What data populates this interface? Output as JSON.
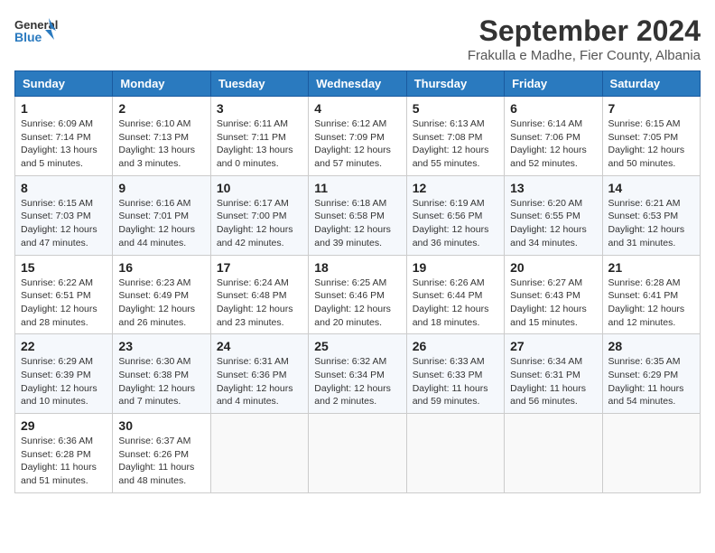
{
  "logo": {
    "line1": "General",
    "line2": "Blue"
  },
  "title": {
    "month_year": "September 2024",
    "location": "Frakulla e Madhe, Fier County, Albania"
  },
  "header_days": [
    "Sunday",
    "Monday",
    "Tuesday",
    "Wednesday",
    "Thursday",
    "Friday",
    "Saturday"
  ],
  "weeks": [
    [
      {
        "day": "1",
        "info": "Sunrise: 6:09 AM\nSunset: 7:14 PM\nDaylight: 13 hours\nand 5 minutes."
      },
      {
        "day": "2",
        "info": "Sunrise: 6:10 AM\nSunset: 7:13 PM\nDaylight: 13 hours\nand 3 minutes."
      },
      {
        "day": "3",
        "info": "Sunrise: 6:11 AM\nSunset: 7:11 PM\nDaylight: 13 hours\nand 0 minutes."
      },
      {
        "day": "4",
        "info": "Sunrise: 6:12 AM\nSunset: 7:09 PM\nDaylight: 12 hours\nand 57 minutes."
      },
      {
        "day": "5",
        "info": "Sunrise: 6:13 AM\nSunset: 7:08 PM\nDaylight: 12 hours\nand 55 minutes."
      },
      {
        "day": "6",
        "info": "Sunrise: 6:14 AM\nSunset: 7:06 PM\nDaylight: 12 hours\nand 52 minutes."
      },
      {
        "day": "7",
        "info": "Sunrise: 6:15 AM\nSunset: 7:05 PM\nDaylight: 12 hours\nand 50 minutes."
      }
    ],
    [
      {
        "day": "8",
        "info": "Sunrise: 6:15 AM\nSunset: 7:03 PM\nDaylight: 12 hours\nand 47 minutes."
      },
      {
        "day": "9",
        "info": "Sunrise: 6:16 AM\nSunset: 7:01 PM\nDaylight: 12 hours\nand 44 minutes."
      },
      {
        "day": "10",
        "info": "Sunrise: 6:17 AM\nSunset: 7:00 PM\nDaylight: 12 hours\nand 42 minutes."
      },
      {
        "day": "11",
        "info": "Sunrise: 6:18 AM\nSunset: 6:58 PM\nDaylight: 12 hours\nand 39 minutes."
      },
      {
        "day": "12",
        "info": "Sunrise: 6:19 AM\nSunset: 6:56 PM\nDaylight: 12 hours\nand 36 minutes."
      },
      {
        "day": "13",
        "info": "Sunrise: 6:20 AM\nSunset: 6:55 PM\nDaylight: 12 hours\nand 34 minutes."
      },
      {
        "day": "14",
        "info": "Sunrise: 6:21 AM\nSunset: 6:53 PM\nDaylight: 12 hours\nand 31 minutes."
      }
    ],
    [
      {
        "day": "15",
        "info": "Sunrise: 6:22 AM\nSunset: 6:51 PM\nDaylight: 12 hours\nand 28 minutes."
      },
      {
        "day": "16",
        "info": "Sunrise: 6:23 AM\nSunset: 6:49 PM\nDaylight: 12 hours\nand 26 minutes."
      },
      {
        "day": "17",
        "info": "Sunrise: 6:24 AM\nSunset: 6:48 PM\nDaylight: 12 hours\nand 23 minutes."
      },
      {
        "day": "18",
        "info": "Sunrise: 6:25 AM\nSunset: 6:46 PM\nDaylight: 12 hours\nand 20 minutes."
      },
      {
        "day": "19",
        "info": "Sunrise: 6:26 AM\nSunset: 6:44 PM\nDaylight: 12 hours\nand 18 minutes."
      },
      {
        "day": "20",
        "info": "Sunrise: 6:27 AM\nSunset: 6:43 PM\nDaylight: 12 hours\nand 15 minutes."
      },
      {
        "day": "21",
        "info": "Sunrise: 6:28 AM\nSunset: 6:41 PM\nDaylight: 12 hours\nand 12 minutes."
      }
    ],
    [
      {
        "day": "22",
        "info": "Sunrise: 6:29 AM\nSunset: 6:39 PM\nDaylight: 12 hours\nand 10 minutes."
      },
      {
        "day": "23",
        "info": "Sunrise: 6:30 AM\nSunset: 6:38 PM\nDaylight: 12 hours\nand 7 minutes."
      },
      {
        "day": "24",
        "info": "Sunrise: 6:31 AM\nSunset: 6:36 PM\nDaylight: 12 hours\nand 4 minutes."
      },
      {
        "day": "25",
        "info": "Sunrise: 6:32 AM\nSunset: 6:34 PM\nDaylight: 12 hours\nand 2 minutes."
      },
      {
        "day": "26",
        "info": "Sunrise: 6:33 AM\nSunset: 6:33 PM\nDaylight: 11 hours\nand 59 minutes."
      },
      {
        "day": "27",
        "info": "Sunrise: 6:34 AM\nSunset: 6:31 PM\nDaylight: 11 hours\nand 56 minutes."
      },
      {
        "day": "28",
        "info": "Sunrise: 6:35 AM\nSunset: 6:29 PM\nDaylight: 11 hours\nand 54 minutes."
      }
    ],
    [
      {
        "day": "29",
        "info": "Sunrise: 6:36 AM\nSunset: 6:28 PM\nDaylight: 11 hours\nand 51 minutes."
      },
      {
        "day": "30",
        "info": "Sunrise: 6:37 AM\nSunset: 6:26 PM\nDaylight: 11 hours\nand 48 minutes."
      },
      null,
      null,
      null,
      null,
      null
    ]
  ]
}
